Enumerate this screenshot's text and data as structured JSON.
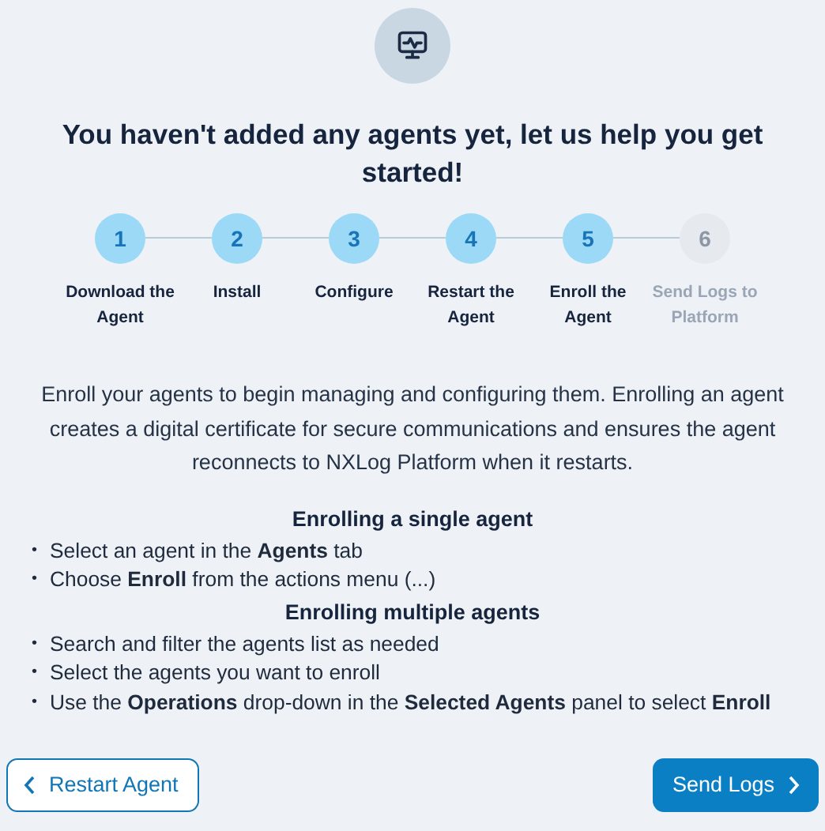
{
  "title": "You haven't added any agents yet, let us help you get started!",
  "steps": [
    {
      "number": "1",
      "label": "Download the Agent",
      "completed": true
    },
    {
      "number": "2",
      "label": "Install",
      "completed": true
    },
    {
      "number": "3",
      "label": "Configure",
      "completed": true
    },
    {
      "number": "4",
      "label": "Restart the Agent",
      "completed": true
    },
    {
      "number": "5",
      "label": "Enroll the Agent",
      "completed": true
    },
    {
      "number": "6",
      "label": "Send Logs to Platform",
      "completed": false
    }
  ],
  "description": "Enroll your agents to begin managing and configuring them. Enrolling an agent creates a digital certificate for secure communications and ensures the agent reconnects to NXLog Platform when it restarts.",
  "sections": [
    {
      "heading": "Enrolling a single agent",
      "items": [
        {
          "bullet": "•",
          "text": "Select an agent in the **Agents** tab"
        },
        {
          "bullet": "•",
          "text": "Choose **Enroll** from the actions menu (...)"
        }
      ]
    },
    {
      "heading": "Enrolling multiple agents",
      "items": [
        {
          "bullet": "•",
          "text": "Search and filter the agents list as needed"
        },
        {
          "bullet": "•",
          "text": "Select the agents you want to enroll"
        },
        {
          "bullet": "•",
          "text": "Use the **Operations** drop-down in the **Selected Agents** panel to select **Enroll**"
        }
      ]
    }
  ],
  "back_button": "Restart Agent",
  "next_button": "Send Logs"
}
